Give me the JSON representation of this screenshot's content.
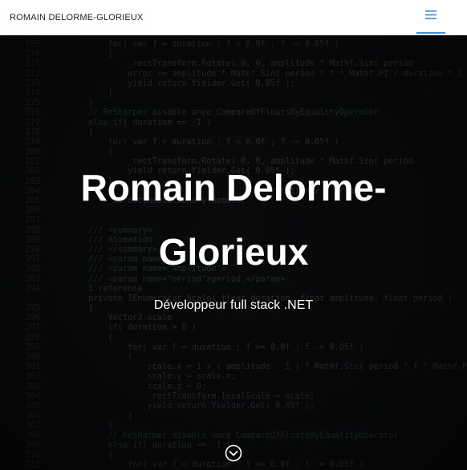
{
  "navbar": {
    "brand": "ROMAIN DELORME-GLORIEUX",
    "menu_icon": "hamburger-menu-icon",
    "accent_color": "#3b8fd9"
  },
  "hero": {
    "title": "Romain Delorme-Glorieux",
    "subtitle": "Développeur full stack .NET",
    "scroll_icon": "chevron-down-circle-icon",
    "background": "code-editor-screenshot",
    "code_lines": [
      {
        "n": "269",
        "t": "    for( var f = duration ; f > 0.0f ; f -= 0.05f )"
      },
      {
        "n": "270",
        "t": "    {"
      },
      {
        "n": "271",
        "t": "        _rectTransform.Rotate( 0, 0, amplitude * Mathf.Sin( period"
      },
      {
        "n": "272",
        "t": "        error += amplitude * Mathf.Sin( period * f * Mathf.PI / duration * 2 );"
      },
      {
        "n": "273",
        "t": "        yield return Yielder.Get( 0.05f );"
      },
      {
        "n": "274",
        "t": "    }"
      },
      {
        "n": "275",
        "t": "}"
      },
      {
        "n": "276",
        "t": "// ReSharper disable once CompareOfFloatsByEqualityOperator"
      },
      {
        "n": "277",
        "t": "else if( duration == -1 )"
      },
      {
        "n": "278",
        "t": "{"
      },
      {
        "n": "279",
        "t": "    for( var f = duration ; f < 0.0f ; f -= 0.05f )"
      },
      {
        "n": "280",
        "t": "    {"
      },
      {
        "n": "281",
        "t": "        _rectTransform.Rotate( 0, 0, amplitude * Mathf.Sin( period"
      },
      {
        "n": "282",
        "t": "        yield return Yielder.Get( 0.05f );"
      },
      {
        "n": "283",
        "t": "    }"
      },
      {
        "n": "284",
        "t": "                                     rotation.z - error"
      },
      {
        "n": "285",
        "t": "    _coroutineDictionary.Remove( "
      },
      {
        "n": "286",
        "t": ""
      },
      {
        "n": "287",
        "t": ""
      },
      {
        "n": "288",
        "t": "/// <summary>"
      },
      {
        "n": "289",
        "t": "/// Animation"
      },
      {
        "n": "290",
        "t": "/// </summary>"
      },
      {
        "n": "291",
        "t": "/// <param name"
      },
      {
        "n": "292",
        "t": "/// <param name=\"amplitude\">"
      },
      {
        "n": "293",
        "t": "/// <param name=\"period\">period.</param>"
      },
      {
        "n": "294",
        "t": "1 reference"
      },
      {
        "n": "",
        "t": "private IEnumerator Scale( float duration, float amplitude, float period )"
      },
      {
        "n": "295",
        "t": "{"
      },
      {
        "n": "296",
        "t": "    Vector3 scale"
      },
      {
        "n": "297",
        "t": "    if( duration > 0 )"
      },
      {
        "n": "298",
        "t": "    {"
      },
      {
        "n": "299",
        "t": "        for( var f = duration ; f >= 0.0f ; f -= 0.05f )"
      },
      {
        "n": "300",
        "t": "        {"
      },
      {
        "n": "301",
        "t": "            scale.x = 1 + ( amplitude - 1 ) * Mathf.Sin( period * f * Mathf.PI"
      },
      {
        "n": "302",
        "t": "            scale.y = scale.x;"
      },
      {
        "n": "303",
        "t": "            scale.z = 0;"
      },
      {
        "n": "304",
        "t": "            _rectTransform.localScale = scale;"
      },
      {
        "n": "305",
        "t": "            yield return Yielder.Get( 0.05f );"
      },
      {
        "n": "306",
        "t": "        }"
      },
      {
        "n": "307",
        "t": "    }"
      },
      {
        "n": "308",
        "t": "    // ReSharper disable once CompareOfFloatsByEqualityOperator"
      },
      {
        "n": "309",
        "t": "    else if( duration == -1 )"
      },
      {
        "n": "310",
        "t": "    {"
      },
      {
        "n": "311",
        "t": "        for( var f = duration ; f <= 0.0f ; f -= 0.05f )"
      },
      {
        "n": "312",
        "t": "            scale.x = 1 + ( amplitude - 1 ) * Mathf.Sin( period * f"
      }
    ]
  }
}
